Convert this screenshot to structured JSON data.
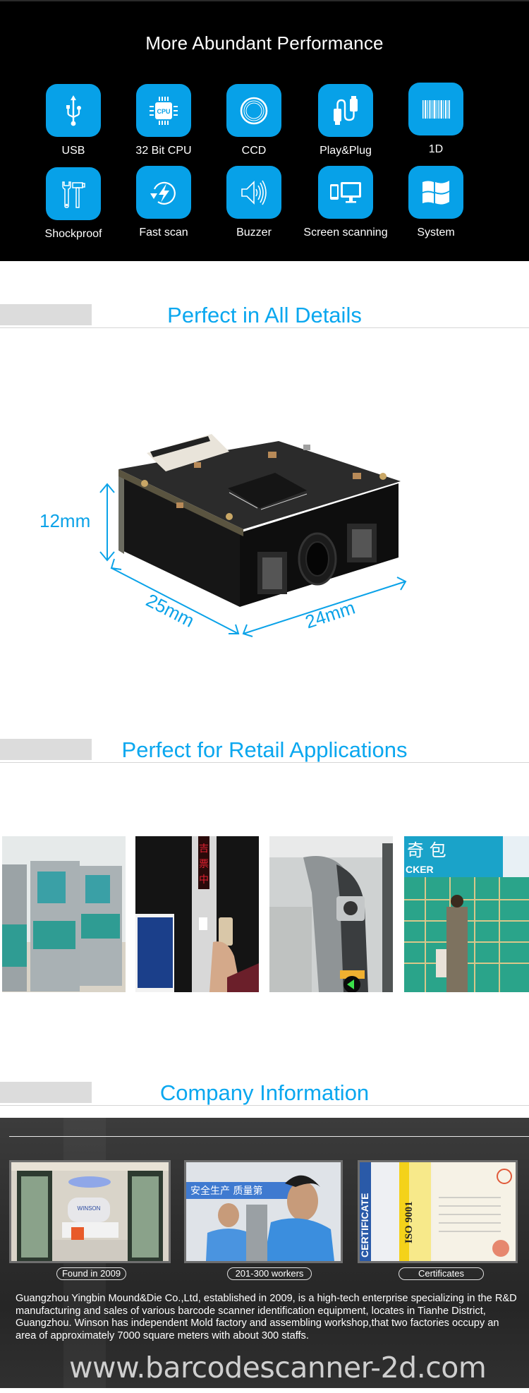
{
  "performance": {
    "title": "More Abundant Performance",
    "accent": "#07a1e8",
    "features": [
      {
        "label": "USB",
        "icon": "usb-icon"
      },
      {
        "label": "32 Bit CPU",
        "icon": "cpu-icon"
      },
      {
        "label": "CCD",
        "icon": "ccd-lens-icon"
      },
      {
        "label": "Play&Plug",
        "icon": "plug-cable-icon"
      },
      {
        "label": "1D",
        "icon": "barcode-icon"
      },
      {
        "label": "Shockproof",
        "icon": "wrench-hammer-icon"
      },
      {
        "label": "Fast scan",
        "icon": "lightning-refresh-icon"
      },
      {
        "label": "Buzzer",
        "icon": "speaker-icon"
      },
      {
        "label": "Screen scanning",
        "icon": "phone-monitor-icon"
      },
      {
        "label": "System",
        "icon": "windows-icon"
      }
    ]
  },
  "details": {
    "title": "Perfect in All Details",
    "dimensions": {
      "height": "12mm",
      "depth": "25mm",
      "width": "24mm"
    }
  },
  "retail": {
    "title": "Perfect for Retail Applications",
    "photos": [
      {
        "alt": "self-service kiosks"
      },
      {
        "alt": "phone scanning at ticket gate"
      },
      {
        "alt": "subway turnstile scanner"
      },
      {
        "alt": "storage locker",
        "sign_text": "CKER"
      }
    ]
  },
  "company": {
    "title": "Company Information",
    "highlights": [
      {
        "label": "Found in 2009"
      },
      {
        "label": "201-300 workers"
      },
      {
        "label": "Certificates"
      }
    ],
    "description": "Guangzhou Yingbin Mound&Die Co.,Ltd, established in 2009, is a high-tech enterprise specializing in the R&D manufacturing and sales of various barcode scanner identification equipment, locates in Tianhe District, Guangzhou. Winson has independent Mold factory and assembling workshop,that two factories occupy an area of approximately 7000 square meters with about 300 staffs.",
    "website": "www.barcodescanner-2d.com",
    "certificate_text": "CERTIFICATE",
    "iso_text": "ISO 9001"
  }
}
